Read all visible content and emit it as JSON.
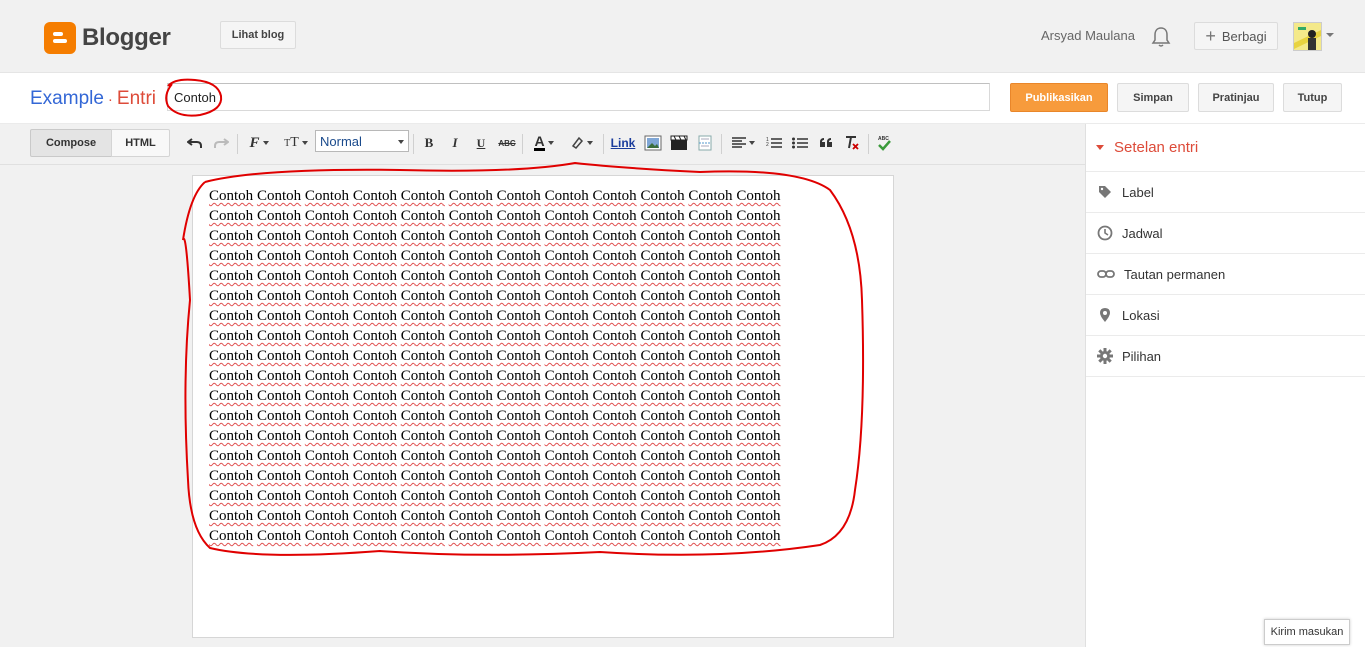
{
  "header": {
    "brand": "Blogger",
    "view_blog_label": "Lihat blog",
    "user_name": "Arsyad Maulana",
    "share_label": "Berbagi"
  },
  "title_row": {
    "blog_name": "Example",
    "separator": "·",
    "section": "Entri",
    "post_title_value": "Contoh",
    "publish_label": "Publikasikan",
    "save_label": "Simpan",
    "preview_label": "Pratinjau",
    "close_label": "Tutup"
  },
  "toolbar": {
    "compose_label": "Compose",
    "html_label": "HTML",
    "font_size_value": "Normal",
    "link_label": "Link",
    "icons": [
      "undo-icon",
      "redo-icon",
      "font-family-icon",
      "font-size-icon",
      "bold-icon",
      "italic-icon",
      "underline-icon",
      "strikethrough-icon",
      "text-color-icon",
      "highlight-icon",
      "link-icon",
      "image-icon",
      "video-icon",
      "jump-break-icon",
      "align-icon",
      "numbered-list-icon",
      "bulleted-list-icon",
      "quote-icon",
      "clear-format-icon",
      "spellcheck-icon"
    ]
  },
  "editor": {
    "word": "Contoh",
    "words_per_line": 12,
    "lines": 18
  },
  "sidebar": {
    "title": "Setelan entri",
    "items": [
      {
        "label": "Label",
        "icon": "tag-icon"
      },
      {
        "label": "Jadwal",
        "icon": "clock-icon"
      },
      {
        "label": "Tautan permanen",
        "icon": "permalink-icon"
      },
      {
        "label": "Lokasi",
        "icon": "location-pin-icon"
      },
      {
        "label": "Pilihan",
        "icon": "gear-icon"
      }
    ]
  },
  "feedback_label": "Kirim masukan",
  "colors": {
    "accent_orange": "#f79b3c",
    "title_blue": "#3367d6",
    "title_red": "#dd4b39",
    "annotation_red": "#e00000"
  }
}
